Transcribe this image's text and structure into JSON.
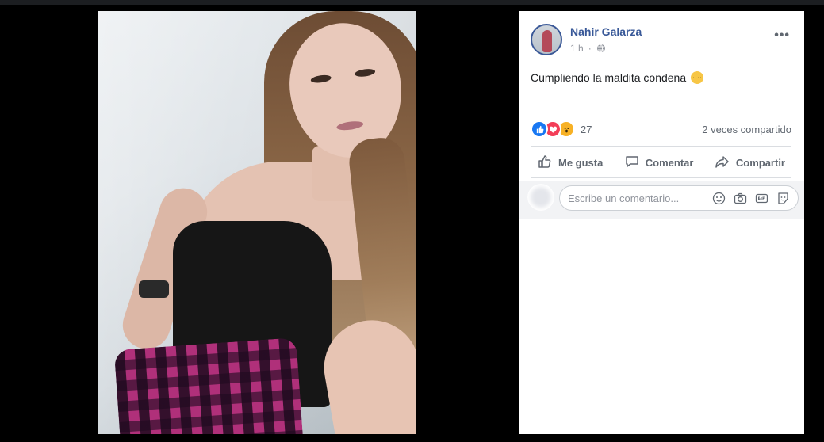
{
  "post": {
    "author": "Nahir Galarza",
    "time": "1 h",
    "text": "Cumpliendo la maldita condena",
    "reaction_count": "27",
    "shares": "2 veces compartido"
  },
  "actions": {
    "like": "Me gusta",
    "comment": "Comentar",
    "share": "Compartir"
  },
  "comment_box": {
    "placeholder": "Escribe un comentario..."
  },
  "colors": {
    "author_link": "#385898",
    "like": "#1877f2",
    "love": "#f33e58",
    "wow": "#f7b125"
  }
}
